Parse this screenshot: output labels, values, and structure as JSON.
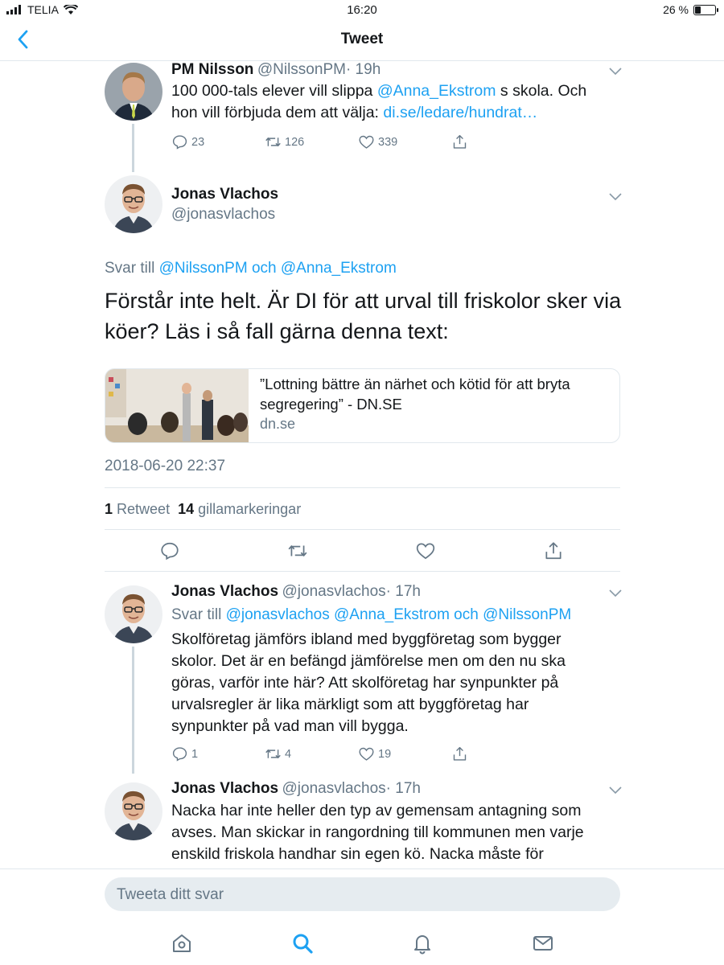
{
  "status_bar": {
    "carrier": "TELIA",
    "time": "16:20",
    "battery": "26 %",
    "battery_level": 0.26
  },
  "nav": {
    "title": "Tweet"
  },
  "parent_tweet": {
    "name": "PM Nilsson",
    "handle": "@NilssonPM",
    "time": "· 19h",
    "text_a": "100 000-tals elever vill slippa ",
    "mention": "@Anna_Ekstrom",
    "text_b": " s skola. Och",
    "text_line2": "hon vill förbjuda dem att välja: ",
    "link": "di.se/ledare/hundrat…",
    "replies": "23",
    "retweets": "126",
    "likes": "339"
  },
  "main_tweet": {
    "name": "Jonas Vlachos",
    "handle": "@jonasvlachos",
    "reply_to_label": "Svar till ",
    "reply_to_1": "@NilssonPM",
    "reply_to_and": " och ",
    "reply_to_2": "@Anna_Ekstrom",
    "text_line1": "Förstår inte helt. Är DI för att urval till friskolor sker via",
    "text_line2": "köer? Läs i så fall gärna denna text:",
    "card_title": "”Lottning bättre än närhet och kötid för att bryta segregering” - DN.SE",
    "card_domain": "dn.se",
    "timestamp": "2018-06-20 22:37",
    "retweet_count": "1",
    "retweet_label": "Retweet",
    "like_count": "14",
    "like_label": "gillamarkeringar"
  },
  "reply_1": {
    "name": "Jonas Vlachos",
    "handle": "@jonasvlachos",
    "time": "· 17h",
    "reply_to_label": "Svar till ",
    "reply_to_1": "@jonasvlachos",
    "reply_to_sp": " ",
    "reply_to_2": "@Anna_Ekstrom",
    "reply_to_and": " och ",
    "reply_to_3": "@NilssonPM",
    "lines": [
      "Skolföretag jämförs ibland med byggföretag som bygger",
      "skolor. Det är en befängd jämförelse men om den nu ska",
      "göras, varför inte här? Att skolföretag har synpunkter på",
      "urvalsregler är lika märkligt som att byggföretag har",
      "synpunkter på vad man vill bygga."
    ],
    "replies": "1",
    "retweets": "4",
    "likes": "19"
  },
  "reply_2": {
    "name": "Jonas Vlachos",
    "handle": "@jonasvlachos",
    "time": "· 17h",
    "lines": [
      "Nacka har inte heller den typ av gemensam antagning som",
      "avses. Man skickar in rangordning till kommunen men varje",
      "enskild friskola handhar sin egen kö. Nacka måste för"
    ]
  },
  "reply_box": {
    "placeholder": "Tweeta ditt svar"
  },
  "colors": {
    "accent": "#1da1f2",
    "secondary_text": "#657786",
    "divider": "#e1e8ed"
  },
  "icons": [
    "back-chevron-icon",
    "reply-icon",
    "retweet-icon",
    "like-icon",
    "share-icon",
    "home-icon",
    "search-icon",
    "notifications-icon",
    "messages-icon"
  ]
}
